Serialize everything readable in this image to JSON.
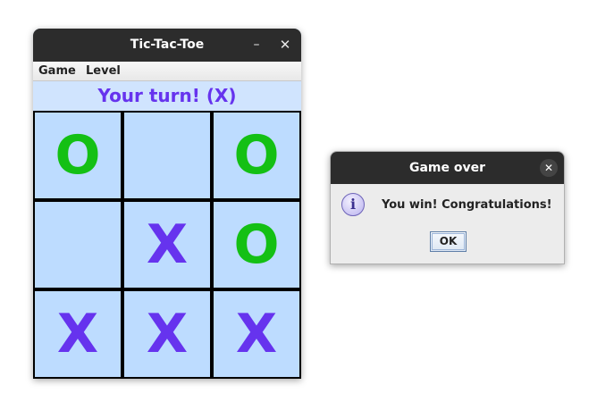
{
  "game_window": {
    "title": "Tic-Tac-Toe",
    "minimize_glyph": "–",
    "close_glyph": "✕",
    "menu": [
      "Game",
      "Level"
    ],
    "status": "Your turn! (X)",
    "board": [
      "O",
      "",
      "O",
      "",
      "X",
      "O",
      "X",
      "X",
      "X"
    ],
    "colors": {
      "o_mark": "#14c014",
      "x_mark": "#6633ee",
      "status_text": "#6633ee",
      "cell_background": "#bddcff"
    }
  },
  "dialog": {
    "title": "Game over",
    "close_glyph": "✕",
    "icon": "info-icon",
    "icon_glyph": "i",
    "message": "You win! Congratulations!",
    "ok_label": "OK"
  }
}
